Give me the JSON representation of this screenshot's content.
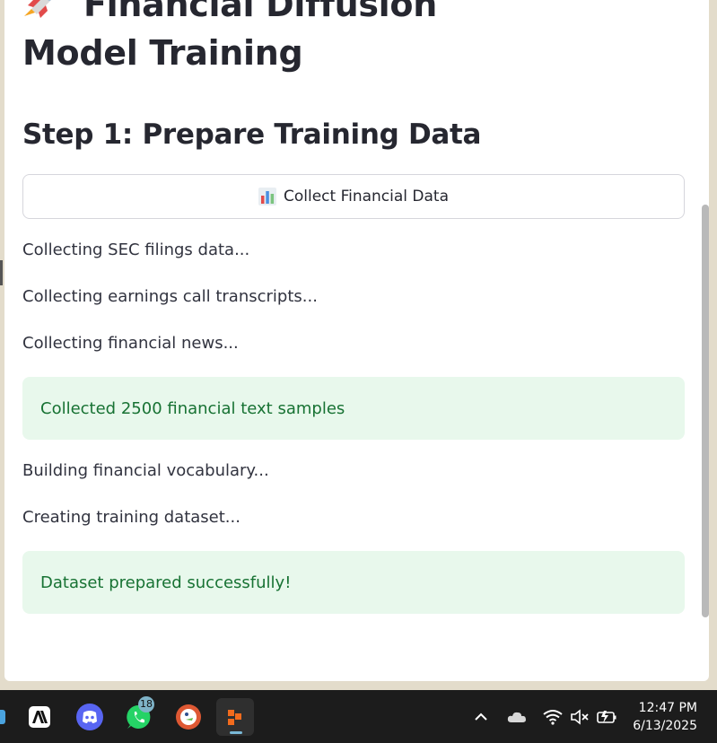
{
  "page": {
    "title": "Financial Diffusion Model Training",
    "title_icon": "rocket-icon",
    "step_heading": "Step 1: Prepare Training Data",
    "collect_button": {
      "label": "Collect Financial Data",
      "icon": "bar-chart-icon"
    },
    "log": [
      "Collecting SEC filings data...",
      "Collecting earnings call transcripts...",
      "Collecting financial news...",
      "Building financial vocabulary...",
      "Creating training dataset..."
    ],
    "success_messages": [
      "Collected 2500 financial text samples",
      "Dataset prepared successfully!"
    ],
    "colors": {
      "success_bg": "#e8f8ec",
      "success_text": "#177233",
      "text": "#262730"
    }
  },
  "taskbar": {
    "apps": [
      {
        "name": "anthropic-app-icon"
      },
      {
        "name": "discord-icon"
      },
      {
        "name": "whatsapp-icon",
        "badge": "18"
      },
      {
        "name": "duckduckgo-icon"
      },
      {
        "name": "terminal-app-icon",
        "active": true
      }
    ],
    "tray": [
      "chevron-up-icon",
      "cloud-icon",
      "wifi-icon",
      "volume-muted-icon",
      "battery-icon"
    ],
    "time": "12:47 PM",
    "date": "6/13/2025"
  }
}
